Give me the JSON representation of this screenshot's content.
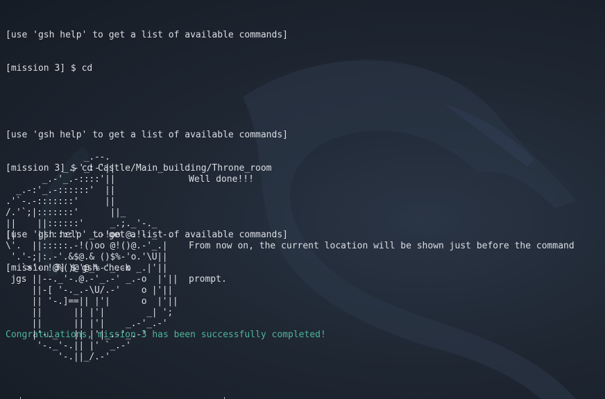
{
  "terminal": {
    "lines": [
      {
        "text": "[use 'gsh help' to get a list of available commands]",
        "kind": "hint"
      },
      {
        "text": "[mission 3] $ cd",
        "kind": "prompt"
      },
      {
        "text": "",
        "kind": "blank"
      },
      {
        "text": "[use 'gsh help' to get a list of available commands]",
        "kind": "hint"
      },
      {
        "text": "[mission 3] $ cd Castle/Main_building/Throne_room",
        "kind": "prompt"
      },
      {
        "text": "",
        "kind": "blank"
      },
      {
        "text": "[use 'gsh help' to get a list of available commands]",
        "kind": "hint"
      },
      {
        "text": "[mission 3] $ gsh check",
        "kind": "prompt"
      },
      {
        "text": "",
        "kind": "blank"
      },
      {
        "text": "Congratulations, mission 3 has been successfully completed!",
        "kind": "success"
      }
    ],
    "success_color": "#4fb59a"
  },
  "ascii_art": {
    "text": "               _.--.\n           _.-'_:-'||\n       _.-'_.-::::'||\n  _.-:'_.-::::::'  ||\n.'`-.-:::::::'     ||\n/.'`;|:::::::'      ||_\n||    ||::::::'     _.;._'-._\n||    ||:::::'  _.-!oo @.!-._'-.\n\\'.  ||:::::.-!()oo @!()@.-'_.|\n '.'-;|:.-'.&$@.& ()$%-'o.'\\U||\n   `>'-.!@%()@'@_%-'_.-o _.|'||\n jgs ||--._'-.@.-'_.-' _.-o  |'||\n     ||-[ '-._.-\\U/.-'    o |'||\n     || '-.]==|| |'|      o  |'||\n     ||      || |'|        _| ';\n     ||      || |'|    _.-'_.-'\n     |'-._   || |'|_.-'_.-'\n      '-._'-.|| |' `_.-'\n          '-.||_/.-'"
  },
  "message": {
    "line1": "Well done!!!",
    "line2": "From now on, the current location will be shown just before the command",
    "line3": "prompt."
  },
  "colors": {
    "background": "#1d2430",
    "text": "#dcdfe4",
    "success": "#4fb59a"
  }
}
